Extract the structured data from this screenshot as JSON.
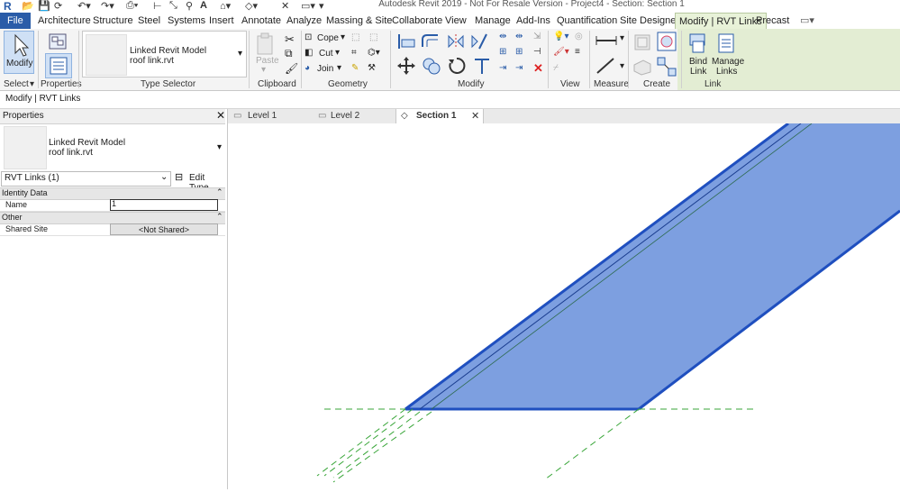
{
  "app": {
    "title": "Autodesk Revit 2019 - Not For Resale Version - Project4 - Section: Section 1",
    "logo": "R"
  },
  "menu": {
    "tabs": [
      "File",
      "Architecture",
      "Structure",
      "Steel",
      "Systems",
      "Insert",
      "Annotate",
      "Analyze",
      "Massing & Site",
      "Collaborate",
      "View",
      "Manage",
      "Add-Ins",
      "Quantification",
      "Site Designer",
      "Modify | RVT Links",
      "Precast"
    ],
    "active": "Modify | RVT Links"
  },
  "ribbon": {
    "select": {
      "modify_label": "Modify",
      "panel_label": "Select"
    },
    "properties": {
      "panel_label": "Properties"
    },
    "type_selector": {
      "line1": "Linked Revit Model",
      "line2": "roof link.rvt",
      "panel_label": "Type Selector"
    },
    "clipboard": {
      "paste_label": "Paste",
      "panel_label": "Clipboard"
    },
    "geometry": {
      "cope_label": "Cope",
      "cut_label": "Cut",
      "join_label": "Join",
      "panel_label": "Geometry"
    },
    "modify": {
      "panel_label": "Modify"
    },
    "view": {
      "panel_label": "View"
    },
    "measure": {
      "panel_label": "Measure"
    },
    "create": {
      "panel_label": "Create"
    },
    "link": {
      "bind_label_1": "Bind",
      "bind_label_2": "Link",
      "manage_label_1": "Manage",
      "manage_label_2": "Links",
      "panel_label": "Link"
    }
  },
  "context_bar": {
    "label": "Modify | RVT Links"
  },
  "properties_palette": {
    "title": "Properties",
    "type_line1": "Linked Revit Model",
    "type_line2": "roof link.rvt",
    "filter": "RVT Links (1)",
    "edit_type": "Edit Type",
    "groups": [
      {
        "name": "Identity Data",
        "rows": [
          {
            "label": "Name",
            "value": "1"
          }
        ]
      },
      {
        "name": "Other",
        "rows": [
          {
            "label": "Shared Site",
            "value": "<Not Shared>"
          }
        ]
      }
    ]
  },
  "view_tabs": [
    {
      "label": "Level 1",
      "active": false
    },
    {
      "label": "Level 2",
      "active": false
    },
    {
      "label": "Section 1",
      "active": true
    }
  ],
  "colors": {
    "file_tab": "#2a5ca8",
    "roof_fill": "#7d9fe0",
    "roof_edge": "#1f4fbf",
    "ref_lines": "#3aa63a",
    "context_tab": "#e8f2d8"
  }
}
